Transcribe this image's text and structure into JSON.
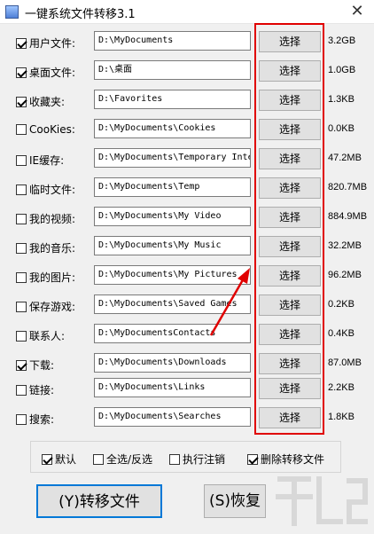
{
  "window": {
    "title": "一键系统文件转移3.1"
  },
  "rows": [
    {
      "label": "用户文件:",
      "checked": true,
      "path": "D:\\MyDocuments",
      "button": "选择",
      "size": "3.2GB"
    },
    {
      "label": "桌面文件:",
      "checked": true,
      "path": "D:\\桌面",
      "button": "选择",
      "size": "1.0GB"
    },
    {
      "label": "收藏夹:",
      "checked": true,
      "path": "D:\\Favorites",
      "button": "选择",
      "size": "1.3KB"
    },
    {
      "label": "CooKies:",
      "checked": false,
      "path": "D:\\MyDocuments\\Cookies",
      "button": "选择",
      "size": "0.0KB"
    },
    {
      "label": "IE缓存:",
      "checked": false,
      "path": "D:\\MyDocuments\\Temporary Inte",
      "button": "选择",
      "size": "47.2MB"
    },
    {
      "label": "临时文件:",
      "checked": false,
      "path": "D:\\MyDocuments\\Temp",
      "button": "选择",
      "size": "820.7MB"
    },
    {
      "label": "我的视频:",
      "checked": false,
      "path": "D:\\MyDocuments\\My Video",
      "button": "选择",
      "size": "884.9MB"
    },
    {
      "label": "我的音乐:",
      "checked": false,
      "path": "D:\\MyDocuments\\My Music",
      "button": "选择",
      "size": "32.2MB"
    },
    {
      "label": "我的图片:",
      "checked": false,
      "path": "D:\\MyDocuments\\My Pictures",
      "button": "选择",
      "size": "96.2MB"
    },
    {
      "label": "保存游戏:",
      "checked": false,
      "path": "D:\\MyDocuments\\Saved Games",
      "button": "选择",
      "size": "0.2KB"
    },
    {
      "label": "联系人:",
      "checked": false,
      "path": "D:\\MyDocumentsContacts",
      "button": "选择",
      "size": "0.4KB"
    },
    {
      "label": "下载:",
      "checked": true,
      "path": "D:\\MyDocuments\\Downloads",
      "button": "选择",
      "size": "87.0MB"
    },
    {
      "label": "链接:",
      "checked": false,
      "path": "D:\\MyDocuments\\Links",
      "button": "选择",
      "size": "2.2KB"
    },
    {
      "label": "搜索:",
      "checked": false,
      "path": "D:\\MyDocuments\\Searches",
      "button": "选择",
      "size": "1.8KB"
    }
  ],
  "options": [
    {
      "label": "默认",
      "checked": true
    },
    {
      "label": "全选/反选",
      "checked": false
    },
    {
      "label": "执行注销",
      "checked": false
    },
    {
      "label": "删除转移文件",
      "checked": true
    }
  ],
  "actions": {
    "transfer_label": "(Y)转移文件",
    "restore_label": "(S)恢复"
  },
  "colors": {
    "highlight": "#e00000",
    "accent": "#0078d7"
  }
}
